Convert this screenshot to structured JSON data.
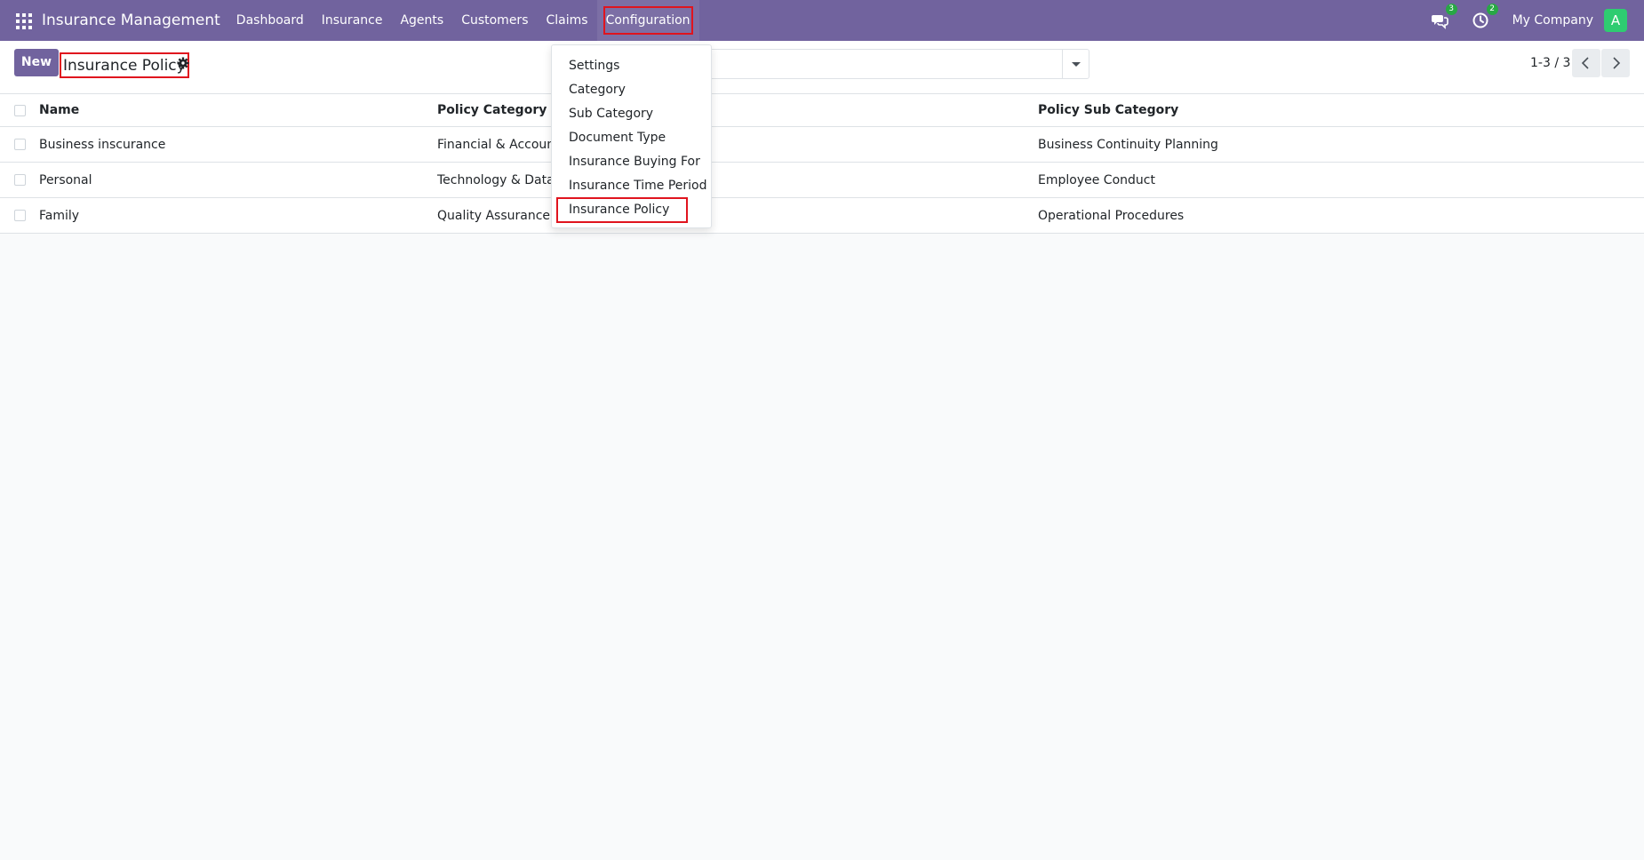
{
  "navbar": {
    "app_title": "Insurance Management",
    "menu": [
      "Dashboard",
      "Insurance",
      "Agents",
      "Customers",
      "Claims",
      "Configuration"
    ],
    "messages_badge": "3",
    "activities_badge": "2",
    "company": "My Company",
    "avatar_initial": "A",
    "bg_color": "#71639e"
  },
  "control_panel": {
    "new_button": "New",
    "breadcrumb": "Insurance Policy",
    "search_placeholder": "",
    "pager": "1-3 / 3"
  },
  "list": {
    "columns": [
      "Name",
      "Policy Category",
      "Policy Sub Category"
    ],
    "rows": [
      [
        "Business inscurance",
        "Financial & Accounting",
        "Business Continuity Planning"
      ],
      [
        "Personal",
        "Technology & Data Usage",
        "Employee Conduct"
      ],
      [
        "Family",
        "Quality Assurance",
        "Operational Procedures"
      ]
    ]
  },
  "config_dropdown": {
    "items": [
      "Settings",
      "Category",
      "Sub Category",
      "Document Type",
      "Insurance Buying For",
      "Insurance Time Period",
      "Insurance Policy"
    ]
  },
  "icons": {
    "apps": "apps-grid-icon",
    "messages": "chat-icon",
    "activities": "clock-icon",
    "gear": "gear-icon",
    "prev": "chevron-left-icon",
    "next": "chevron-right-icon"
  },
  "highlight_color": "#e0141e"
}
